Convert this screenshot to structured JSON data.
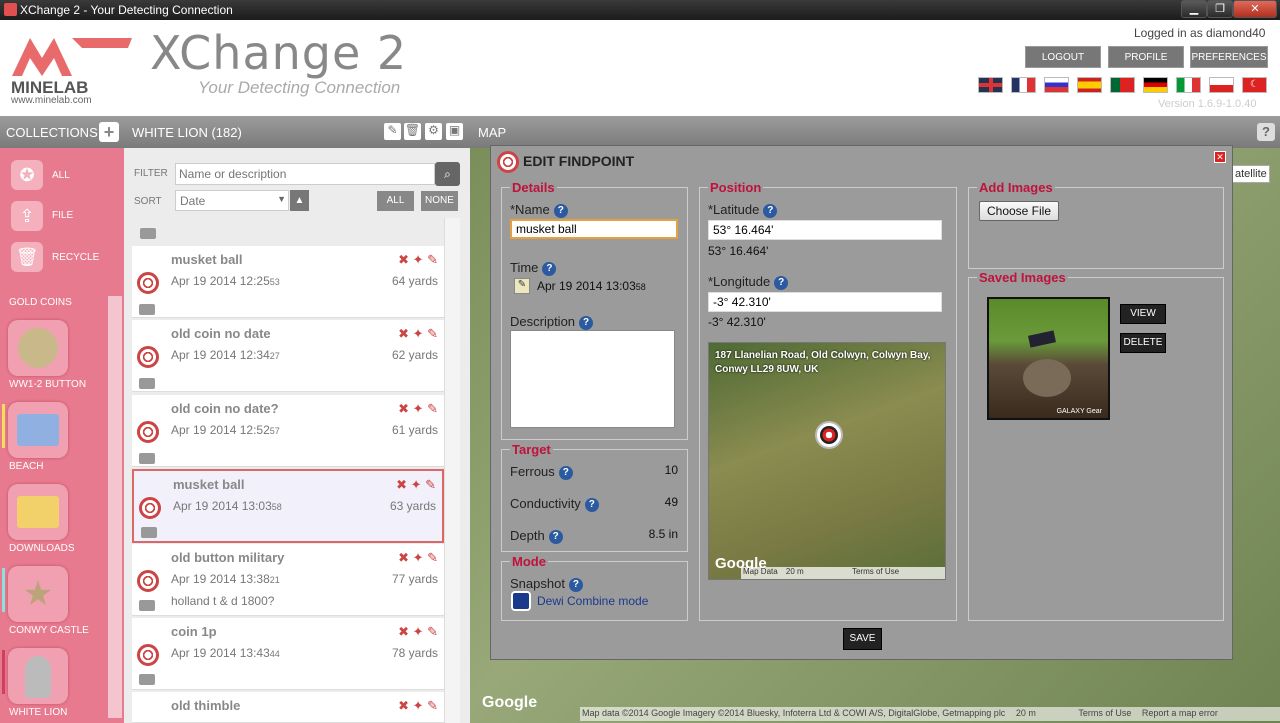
{
  "window": {
    "title": "XChange 2 - Your Detecting Connection"
  },
  "header": {
    "brand": "MINELAB",
    "brand_url": "www.minelab.com",
    "app_name": "XChange 2",
    "tagline": "Your Detecting Connection",
    "logged_in": "Logged in as diamond40",
    "version": "Version 1.6.9-1.0.40",
    "buttons": [
      "LOGOUT",
      "PROFILE",
      "PREFERENCES"
    ],
    "flags": [
      "uk-flag",
      "france-flag",
      "russia-flag",
      "spain-flag",
      "portugal-flag",
      "germany-flag",
      "italy-flag",
      "poland-flag",
      "turkey-flag"
    ]
  },
  "toolbar": {
    "collections": "COLLECTIONS",
    "current": "WHITE LION (182)",
    "map": "MAP",
    "help": "?"
  },
  "sidebar": {
    "top": [
      {
        "label": "ALL",
        "icon": "all-icon"
      },
      {
        "label": "FILE",
        "icon": "file-icon"
      },
      {
        "label": "RECYCLE",
        "icon": "recycle-icon"
      }
    ],
    "collections": [
      {
        "label": "GOLD COINS"
      },
      {
        "label": "WW1-2 BUTTON"
      },
      {
        "label": "BEACH"
      },
      {
        "label": "DOWNLOADS"
      },
      {
        "label": "CONWY CASTLE"
      },
      {
        "label": "WHITE LION"
      }
    ]
  },
  "list": {
    "filter_label": "FILTER",
    "filter_placeholder": "Name or description",
    "sort_label": "SORT",
    "sort_value": "Date",
    "all_button": "ALL",
    "none_button": "NONE",
    "items": [
      {
        "name": "musket ball",
        "date": "Apr 19 2014  12:25",
        "sec": "53",
        "dist": "64 yards",
        "note": ""
      },
      {
        "name": "old coin no date",
        "date": "Apr 19 2014  12:34",
        "sec": "27",
        "dist": "62 yards",
        "note": ""
      },
      {
        "name": "old coin no date?",
        "date": "Apr 19 2014  12:52",
        "sec": "57",
        "dist": "61 yards",
        "note": ""
      },
      {
        "name": "musket ball",
        "date": "Apr 19 2014  13:03",
        "sec": "58",
        "dist": "63 yards",
        "note": ""
      },
      {
        "name": "old button military",
        "date": "Apr 19 2014  13:38",
        "sec": "21",
        "dist": "77 yards",
        "note": "holland t & d 1800?"
      },
      {
        "name": "coin 1p",
        "date": "Apr 19 2014  13:43",
        "sec": "44",
        "dist": "78 yards",
        "note": ""
      },
      {
        "name": "old thimble",
        "date": "",
        "sec": "",
        "dist": "",
        "note": ""
      }
    ]
  },
  "map": {
    "satellite_btn": "atellite",
    "footer": "Map data ©2014 Google Imagery ©2014 Bluesky, Infoterra Ltd & COWI A/S, DigitalGlobe, Getmapping plc",
    "scale": "20 m",
    "terms": "Terms of Use",
    "report": "Report a map error",
    "google": "Google"
  },
  "dialog": {
    "title": "EDIT FINDPOINT",
    "details": {
      "legend": "Details",
      "name_label": "*Name",
      "name_value": "musket ball",
      "time_label": "Time",
      "time_value": "Apr 19 2014  13:03",
      "time_sec": "58",
      "desc_label": "Description"
    },
    "target": {
      "legend": "Target",
      "ferrous_label": "Ferrous",
      "ferrous": "10",
      "cond_label": "Conductivity",
      "cond": "49",
      "depth_label": "Depth",
      "depth": "8.5 in"
    },
    "mode": {
      "legend": "Mode",
      "snapshot_label": "Snapshot",
      "mode_value": "Dewi Combine mode"
    },
    "position": {
      "legend": "Position",
      "lat_label": "*Latitude",
      "lat_value": "53° 16.464'",
      "lat_display": "53° 16.464'",
      "lon_label": "*Longitude",
      "lon_value": "-3° 42.310'",
      "lon_display": "-3° 42.310'",
      "address": "187 Llanelian Road, Old Colwyn, Colwyn Bay, Conwy LL29 8UW, UK",
      "map_data": "Map Data",
      "scale": "20 m",
      "terms": "Terms of Use",
      "google": "Google"
    },
    "add_images": {
      "legend": "Add Images",
      "choose": "Choose File"
    },
    "saved_images": {
      "legend": "Saved Images",
      "view": "VIEW",
      "delete": "DELETE",
      "watermark": "GALAXY Gear"
    },
    "save": "SAVE"
  },
  "colors": {
    "accent": "#c0123c",
    "sidebar": "#e87a8f",
    "toolbar": "#8a8a8a"
  }
}
